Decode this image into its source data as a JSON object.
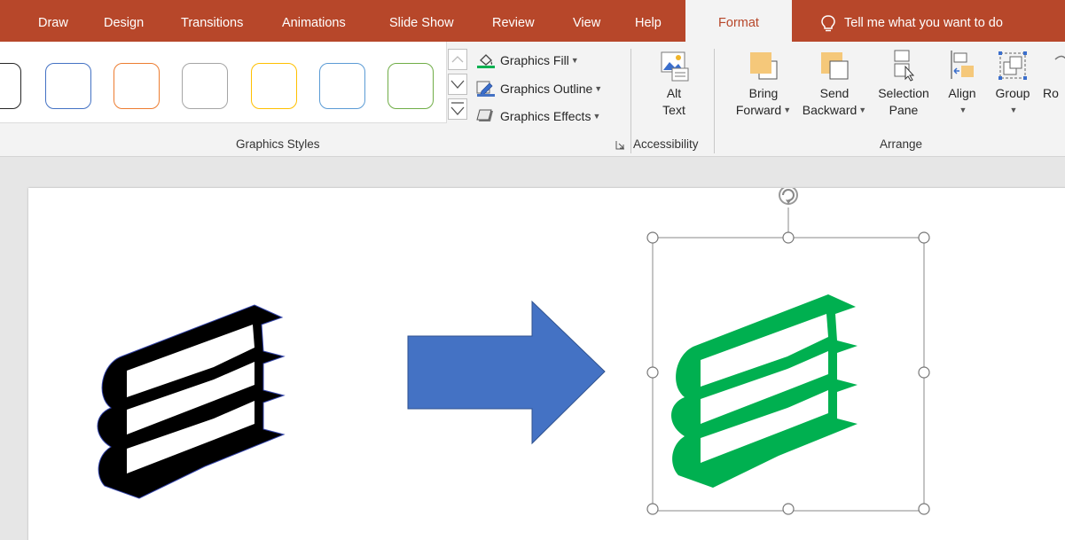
{
  "tabs": [
    {
      "label": "Draw"
    },
    {
      "label": "Design"
    },
    {
      "label": "Transitions"
    },
    {
      "label": "Animations"
    },
    {
      "label": "Slide Show"
    },
    {
      "label": "Review"
    },
    {
      "label": "View"
    },
    {
      "label": "Help"
    },
    {
      "label": "Format",
      "active": true
    }
  ],
  "tell_me": {
    "label": "Tell me what you want to do"
  },
  "graphics_styles": {
    "group_label": "Graphics Styles",
    "swatch_colors": [
      "#262626",
      "#4472c4",
      "#ed7d31",
      "#a5a5a5",
      "#ffc000",
      "#5b9bd5",
      "#70ad47"
    ],
    "fill_label": "Graphics Fill",
    "outline_label": "Graphics Outline",
    "effects_label": "Graphics Effects"
  },
  "accessibility": {
    "group_label": "Accessibility",
    "alt_text_line1": "Alt",
    "alt_text_line2": "Text"
  },
  "arrange": {
    "group_label": "Arrange",
    "bring_forward_line1": "Bring",
    "bring_forward_line2": "Forward",
    "send_backward_line1": "Send",
    "send_backward_line2": "Backward",
    "selection_pane_line1": "Selection",
    "selection_pane_line2": "Pane",
    "align_label": "Align",
    "group_label_btn": "Group",
    "rotate_label": "Ro"
  },
  "colors": {
    "accent": "#b7472a",
    "arrow_fill": "#4472c4",
    "books_original": "#000000",
    "books_recolored": "#00b050"
  },
  "icons": {
    "tell_me": "lightbulb-icon",
    "fill": "paint-bucket-icon",
    "outline": "pencil-icon",
    "effects": "effects-icon",
    "alt_text": "alt-text-icon",
    "bring_forward": "bring-forward-icon",
    "send_backward": "send-backward-icon",
    "selection_pane": "selection-pane-icon",
    "align": "align-icon",
    "group": "group-icon",
    "rotate_handle": "rotate-icon"
  }
}
